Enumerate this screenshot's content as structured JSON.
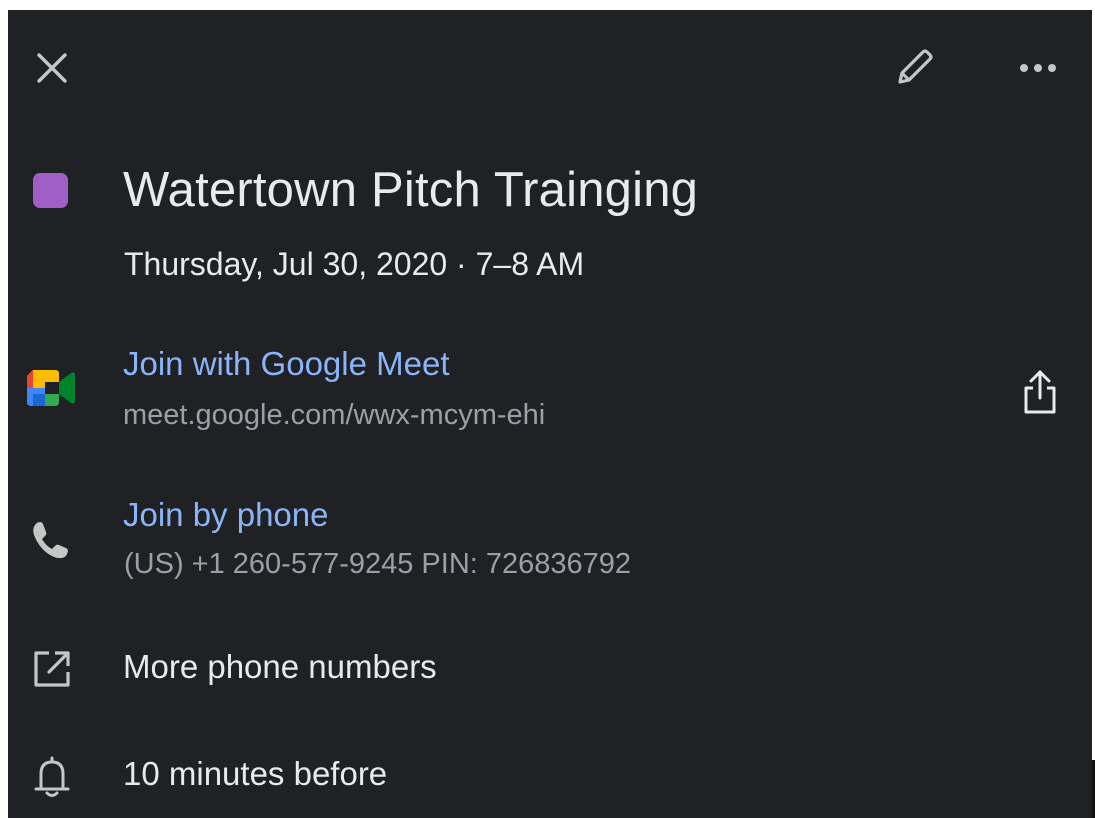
{
  "header": {
    "close_icon": "close-icon",
    "edit_icon": "pencil-icon",
    "more_icon": "more-horizontal-icon"
  },
  "event": {
    "color": "#a05fc7",
    "title": "Watertown Pitch Trainging",
    "datetime": "Thursday, Jul 30, 2020 · 7–8 AM"
  },
  "meet": {
    "icon": "google-meet-icon",
    "label": "Join with Google Meet",
    "url": "meet.google.com/wwx-mcym-ehi",
    "share_icon": "share-icon"
  },
  "phone": {
    "icon": "phone-icon",
    "label": "Join by phone",
    "detail": "(US) +1 260-577-9245 PIN: 726836792"
  },
  "more_numbers": {
    "icon": "open-external-icon",
    "label": "More phone numbers"
  },
  "reminder": {
    "icon": "bell-icon",
    "label": "10 minutes before"
  },
  "colors": {
    "background": "#202124",
    "text_primary": "#e8eaed",
    "text_secondary": "#9aa0a6",
    "link": "#8ab4f8"
  }
}
